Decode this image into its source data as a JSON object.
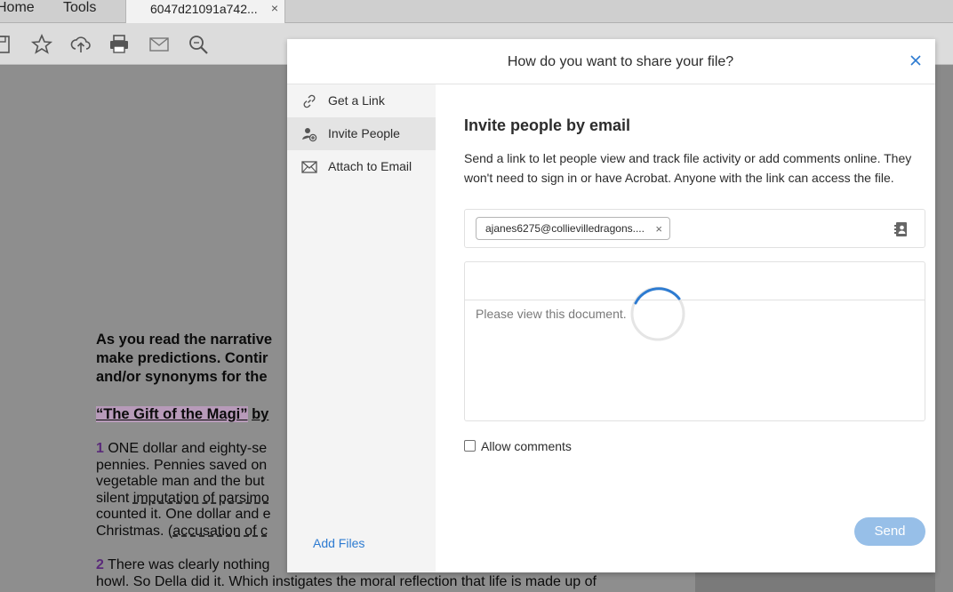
{
  "tabs": {
    "home": "Home",
    "tools": "Tools",
    "document": "6047d21091a742...",
    "close": "×"
  },
  "toolbar": {
    "icons": [
      "save-icon",
      "star-icon",
      "cloud-upload-icon",
      "print-icon",
      "mail-icon",
      "zoom-icon"
    ]
  },
  "document": {
    "lines_bold": [
      "As you read the narrative",
      "make predictions. Contir",
      "and/or synonyms for the"
    ],
    "title_part1": "“The Gift of the Magi”",
    "title_part2": "by",
    "p1_num": "1",
    "p1_line1": "ONE dollar and eighty-se",
    "p1_line2": "pennies. Pennies saved on",
    "p1_line3": "vegetable man and the but",
    "p1_line4_a": "silent ",
    "p1_line4_b": "imputation of parsimo",
    "p1_line5": "counted it. One dollar and e",
    "p1_line6_a": "Christmas. (",
    "p1_line6_b": "accusation of c",
    "p2_num": "2",
    "p2_line1": "There was clearly nothing",
    "p2_line2": "howl. So Della did it. Which instigates the moral reflection that life is made up of"
  },
  "modal": {
    "title": "How do you want to share your file?",
    "close_label": "×",
    "sidebar": {
      "items": [
        {
          "label": "Get a Link",
          "icon": "link-icon"
        },
        {
          "label": "Invite People",
          "icon": "add-person-icon"
        },
        {
          "label": "Attach to Email",
          "icon": "envelope-icon"
        }
      ],
      "add_files": "Add Files"
    },
    "content": {
      "heading": "Invite people by email",
      "description": "Send a link to let people view and track file activity or add comments online. They won't need to sign in or have Acrobat. Anyone with the link can access the file.",
      "recipient_chip": "ajanes6275@collievilledragons....",
      "chip_remove": "×",
      "message": "Please view this document.",
      "allow_comments": "Allow comments",
      "allow_comments_checked": false,
      "send": "Send"
    }
  },
  "colors": {
    "accent": "#2d7bd1",
    "send_disabled": "#97bfe8",
    "highlight": "#b79ab9"
  }
}
